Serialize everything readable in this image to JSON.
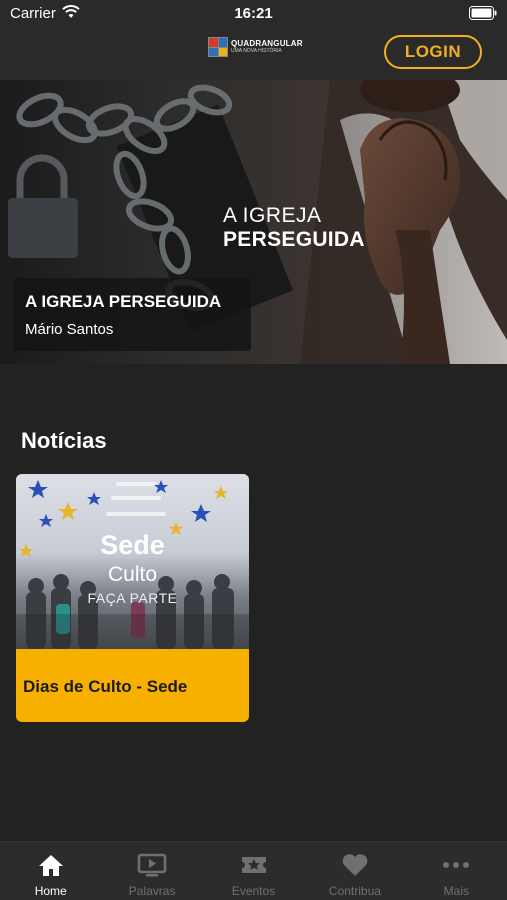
{
  "status_bar": {
    "carrier": "Carrier",
    "time": "16:21"
  },
  "header": {
    "logo_title": "QUADRANGULAR",
    "logo_subtitle": "UMA NOVA HISTÓRIA",
    "login_label": "LOGIN",
    "accent_color": "#f2b01e"
  },
  "hero": {
    "overlay_line1": "A IGREJA",
    "overlay_line2": "PERSEGUIDA",
    "caption_title": "A IGREJA PERSEGUIDA",
    "caption_author": "Mário Santos"
  },
  "news": {
    "section_title": "Notícias",
    "cards": [
      {
        "image_line1": "Sede",
        "image_line2": "Culto",
        "image_line3": "FAÇA PARTE",
        "title": "Dias de Culto - Sede",
        "color": "#f7af00"
      }
    ]
  },
  "tab_bar": {
    "tabs": [
      {
        "label": "Home",
        "icon": "home-icon",
        "active": true
      },
      {
        "label": "Palavras",
        "icon": "play-screen-icon",
        "active": false
      },
      {
        "label": "Eventos",
        "icon": "ticket-star-icon",
        "active": false
      },
      {
        "label": "Contribua",
        "icon": "heart-icon",
        "active": false
      },
      {
        "label": "Mais",
        "icon": "more-dots-icon",
        "active": false
      }
    ]
  }
}
